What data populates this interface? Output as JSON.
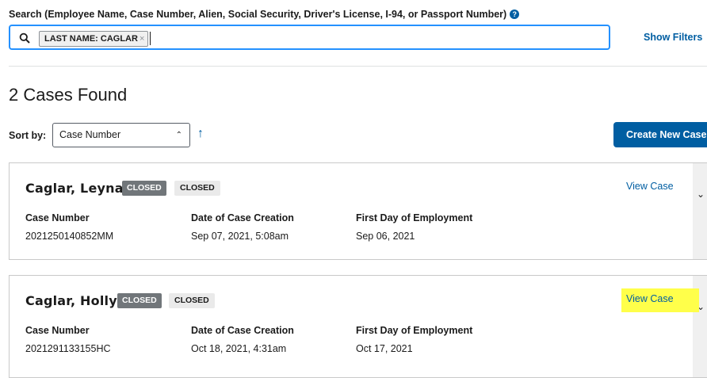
{
  "search": {
    "label": "Search (Employee Name, Case Number, Alien, Social Security, Driver's License, I-94, or Passport Number)",
    "chip": "LAST NAME: CAGLAR",
    "chip_remove": "×",
    "help_icon": "?",
    "show_filters": "Show Filters"
  },
  "results": {
    "count_title": "2 Cases Found",
    "sort_label": "Sort by:",
    "sort_value": "Case Number",
    "sort_direction_icon": "↑",
    "create_button": "Create New Case"
  },
  "labels": {
    "case_number": "Case Number",
    "creation": "Date of Case Creation",
    "first_day": "First Day of Employment",
    "view_case": "View Case"
  },
  "cases": [
    {
      "name": "Caglar, Leyna",
      "status_badge": "CLOSED",
      "status_text": "CLOSED",
      "case_number": "2021250140852MM",
      "created": "Sep 07, 2021, 5:08am",
      "first_day": "Sep 06, 2021"
    },
    {
      "name": "Caglar, Holly",
      "status_badge": "CLOSED",
      "status_text": "CLOSED",
      "case_number": "2021291133155HC",
      "created": "Oct 18, 2021, 4:31am",
      "first_day": "Oct 17, 2021"
    }
  ],
  "colors": {
    "primary": "#005ea2",
    "focus": "#2491ff",
    "highlight": "#ffff4a",
    "badge_dark": "#71767a"
  }
}
